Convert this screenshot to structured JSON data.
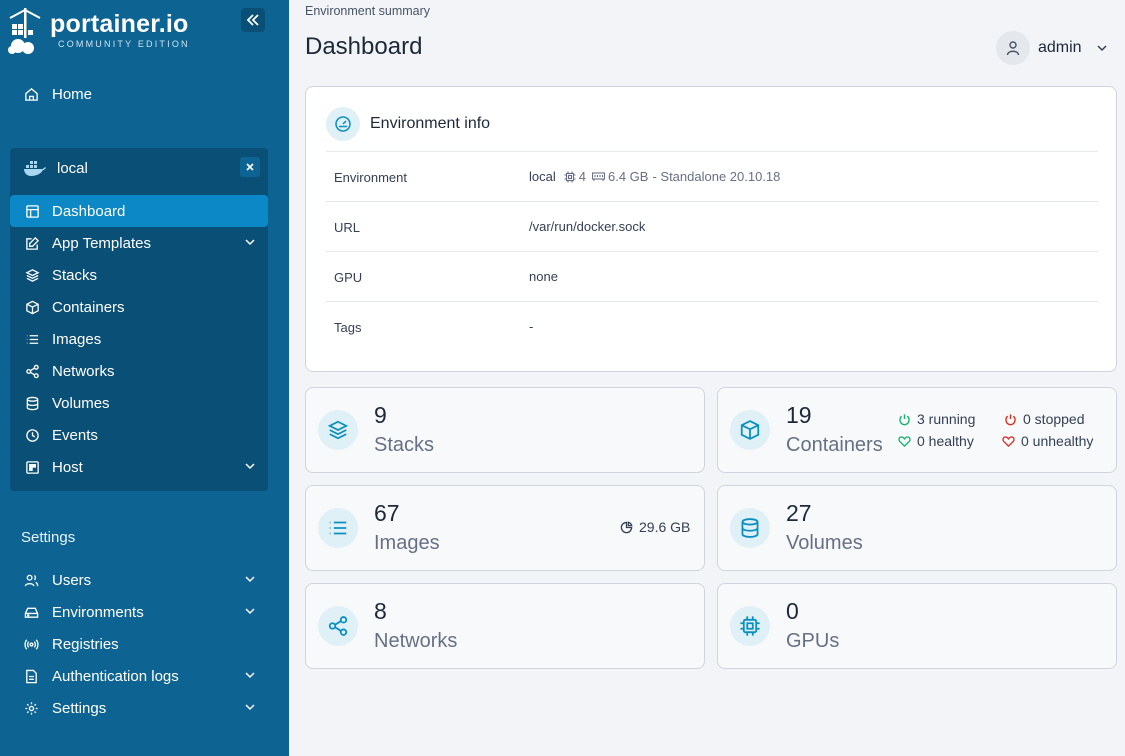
{
  "brand": {
    "name": "portainer.io",
    "edition": "COMMUNITY EDITION"
  },
  "sidebar": {
    "home_label": "Home",
    "environment": {
      "name": "local",
      "items": [
        {
          "label": "Dashboard",
          "icon": "dashboard-icon",
          "active": true
        },
        {
          "label": "App Templates",
          "icon": "edit-icon",
          "expandable": true
        },
        {
          "label": "Stacks",
          "icon": "layers-icon"
        },
        {
          "label": "Containers",
          "icon": "box-icon"
        },
        {
          "label": "Images",
          "icon": "list-icon"
        },
        {
          "label": "Networks",
          "icon": "share-icon"
        },
        {
          "label": "Volumes",
          "icon": "database-icon"
        },
        {
          "label": "Events",
          "icon": "clock-icon"
        },
        {
          "label": "Host",
          "icon": "host-icon",
          "expandable": true
        }
      ]
    },
    "settings_title": "Settings",
    "settings_items": [
      {
        "label": "Users",
        "icon": "users-icon",
        "expandable": true
      },
      {
        "label": "Environments",
        "icon": "hard-drive-icon",
        "expandable": true
      },
      {
        "label": "Registries",
        "icon": "radio-icon"
      },
      {
        "label": "Authentication logs",
        "icon": "file-icon",
        "expandable": true
      },
      {
        "label": "Settings",
        "icon": "gear-icon",
        "expandable": true
      }
    ]
  },
  "header": {
    "breadcrumb": "Environment summary",
    "title": "Dashboard",
    "user": "admin"
  },
  "env_info": {
    "title": "Environment info",
    "rows": {
      "environment": {
        "label": "Environment",
        "name": "local",
        "cpu": "4",
        "memory": "6.4 GB",
        "details": "- Standalone 20.10.18"
      },
      "url": {
        "label": "URL",
        "value": "/var/run/docker.sock"
      },
      "gpu": {
        "label": "GPU",
        "value": "none"
      },
      "tags": {
        "label": "Tags",
        "value": "-"
      }
    }
  },
  "stats": {
    "stacks": {
      "count": "9",
      "label": "Stacks"
    },
    "containers": {
      "count": "19",
      "label": "Containers",
      "running": "3 running",
      "stopped": "0 stopped",
      "healthy": "0 healthy",
      "unhealthy": "0 unhealthy"
    },
    "images": {
      "count": "67",
      "label": "Images",
      "size": "29.6 GB"
    },
    "volumes": {
      "count": "27",
      "label": "Volumes"
    },
    "networks": {
      "count": "8",
      "label": "Networks"
    },
    "gpus": {
      "count": "0",
      "label": "GPUs"
    }
  },
  "colors": {
    "sidebar": "#0d6493",
    "sidebar_dark": "#0a4f75",
    "active": "#0c88c6",
    "accent": "#0b8fc0",
    "running": "#17b26a",
    "stopped": "#d92d20"
  }
}
